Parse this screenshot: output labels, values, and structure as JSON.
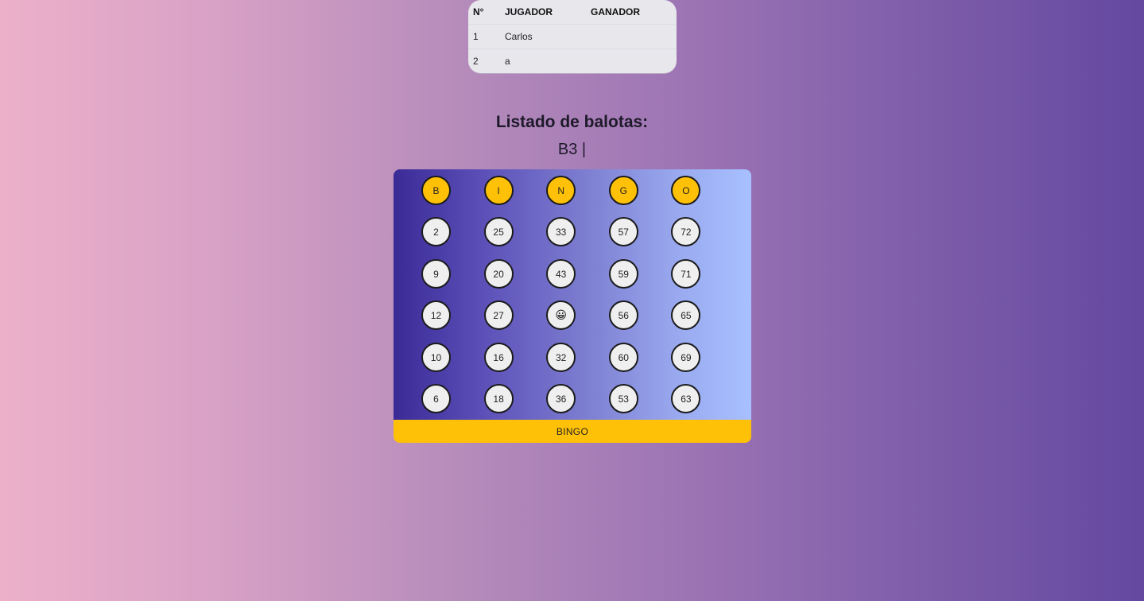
{
  "players_table": {
    "headers": [
      "N°",
      "JUGADOR",
      "GANADOR"
    ],
    "rows": [
      [
        "1",
        "Carlos",
        ""
      ],
      [
        "2",
        "a",
        ""
      ]
    ]
  },
  "balls_title": "Listado de balotas:",
  "balls_drawn": "B3 |",
  "card": {
    "header": [
      "B",
      "I",
      "N",
      "G",
      "O"
    ],
    "rows": [
      [
        "2",
        "25",
        "33",
        "57",
        "72"
      ],
      [
        "9",
        "20",
        "43",
        "59",
        "71"
      ],
      [
        "12",
        "27",
        "😀",
        "56",
        "65"
      ],
      [
        "10",
        "16",
        "32",
        "60",
        "69"
      ],
      [
        "6",
        "18",
        "36",
        "53",
        "63"
      ]
    ],
    "button_label": "BINGO"
  },
  "colors": {
    "ball_header": "#ffc107",
    "ball": "#efefef",
    "button": "#ffc107"
  }
}
